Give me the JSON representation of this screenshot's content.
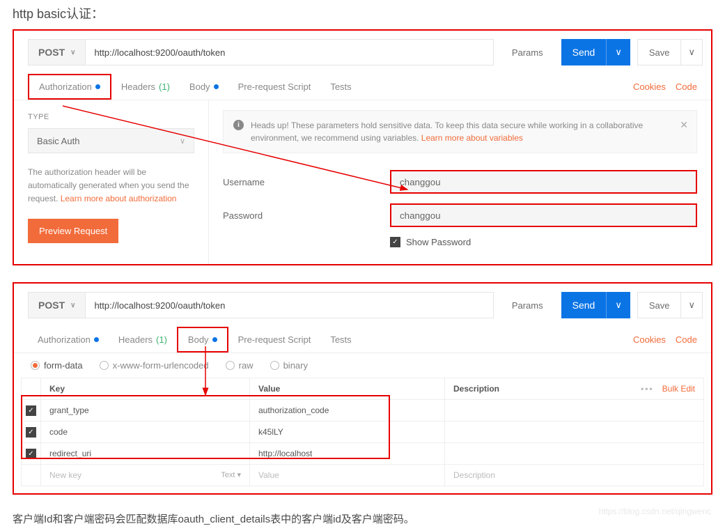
{
  "page_title": "http basic认证：",
  "panel1": {
    "method": "POST",
    "url": "http://localhost:9200/oauth/token",
    "params_btn": "Params",
    "send_btn": "Send",
    "save_btn": "Save",
    "tabs": {
      "authorization": "Authorization",
      "headers": "Headers",
      "headers_count": "(1)",
      "body": "Body",
      "prerequest": "Pre-request Script",
      "tests": "Tests",
      "cookies": "Cookies",
      "code": "Code"
    },
    "auth": {
      "type_label": "TYPE",
      "type_value": "Basic Auth",
      "desc1": "The authorization header will be automatically generated when you send the request. ",
      "desc_link": "Learn more about authorization",
      "preview_btn": "Preview Request",
      "alert_text": "Heads up! These parameters hold sensitive data. To keep this data secure while working in a collaborative environment, we recommend using variables. ",
      "alert_link": "Learn more about variables",
      "username_label": "Username",
      "username_value": "changgou",
      "password_label": "Password",
      "password_value": "changgou",
      "show_password": "Show Password"
    }
  },
  "panel2": {
    "method": "POST",
    "url": "http://localhost:9200/oauth/token",
    "params_btn": "Params",
    "send_btn": "Send",
    "save_btn": "Save",
    "tabs": {
      "authorization": "Authorization",
      "headers": "Headers",
      "headers_count": "(1)",
      "body": "Body",
      "prerequest": "Pre-request Script",
      "tests": "Tests",
      "cookies": "Cookies",
      "code": "Code"
    },
    "body_types": {
      "form_data": "form-data",
      "xwww": "x-www-form-urlencoded",
      "raw": "raw",
      "binary": "binary"
    },
    "table": {
      "headers": {
        "key": "Key",
        "value": "Value",
        "description": "Description",
        "bulk": "Bulk Edit"
      },
      "rows": [
        {
          "key": "grant_type",
          "value": "authorization_code"
        },
        {
          "key": "code",
          "value": "k45lLY"
        },
        {
          "key": "redirect_uri",
          "value": "http://localhost"
        }
      ],
      "placeholder": {
        "key": "New key",
        "type": "Text",
        "value": "Value",
        "description": "Description"
      }
    }
  },
  "footer": "客户端Id和客户端密码会匹配数据库oauth_client_details表中的客户端id及客户端密码。",
  "watermark": "https://blog.csdn.net/qingwenc"
}
